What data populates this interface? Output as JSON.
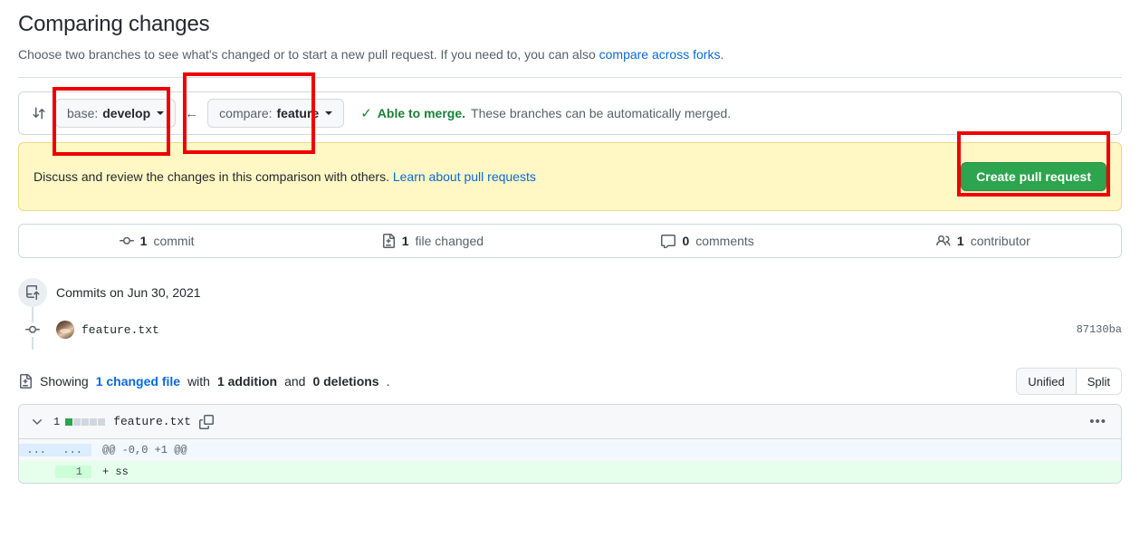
{
  "header": {
    "title": "Comparing changes",
    "subtitle_prefix": "Choose two branches to see what's changed or to start a new pull request. If you need to, you can also ",
    "subtitle_link": "compare across forks",
    "subtitle_suffix": "."
  },
  "compare_bar": {
    "icon": "git-compare-icon",
    "base": {
      "prefix": "base:",
      "value": "develop"
    },
    "arrow": "←",
    "compare": {
      "prefix": "compare:",
      "value": "feature"
    },
    "merge_check": "✓",
    "merge_status_strong": "Able to merge.",
    "merge_status_rest": "These branches can be automatically merged."
  },
  "discuss_banner": {
    "text_prefix": "Discuss and review the changes in this comparison with others. ",
    "link": "Learn about pull requests",
    "button": "Create pull request",
    "button_color": "#2da44e",
    "background_color": "#fff8c5"
  },
  "stats": [
    {
      "icon": "commit-icon",
      "num": "1",
      "label": "commit"
    },
    {
      "icon": "file-diff-icon",
      "num": "1",
      "label": "file changed"
    },
    {
      "icon": "comment-icon",
      "num": "0",
      "label": "comments"
    },
    {
      "icon": "people-icon",
      "num": "1",
      "label": "contributor"
    }
  ],
  "timeline": {
    "badge_icon": "repo-push-icon",
    "date_label": "Commits on Jun 30, 2021",
    "commit": {
      "dot_icon": "commit-dot-icon",
      "avatar": "user-avatar",
      "message": "feature.txt",
      "sha": "87130ba"
    }
  },
  "showing": {
    "icon": "file-diff-icon",
    "prefix": "Showing ",
    "changed_file": "1 changed file",
    "with": " with ",
    "additions": "1 addition",
    "and": " and ",
    "deletions": "0 deletions",
    "period": ".",
    "view_modes": [
      "Unified",
      "Split"
    ],
    "active_view_mode": "Unified"
  },
  "diff": {
    "chevron": "chevron-down-icon",
    "changes_count": "1",
    "diffstat_blocks": [
      "add",
      "neutral",
      "neutral",
      "neutral",
      "neutral"
    ],
    "filename": "feature.txt",
    "copy_icon": "copy-icon",
    "kebab": "•••",
    "lines": [
      {
        "type": "hunk",
        "old_no": "...",
        "new_no": "...",
        "code": "@@ -0,0 +1 @@"
      },
      {
        "type": "add",
        "old_no": "",
        "new_no": "1",
        "code": "+ ss"
      }
    ]
  },
  "annotations": [
    {
      "name": "annotation-base-branch",
      "color": "#ee0000"
    },
    {
      "name": "annotation-compare-branch",
      "color": "#ee0000"
    },
    {
      "name": "annotation-create-pr",
      "color": "#ee0000"
    }
  ]
}
